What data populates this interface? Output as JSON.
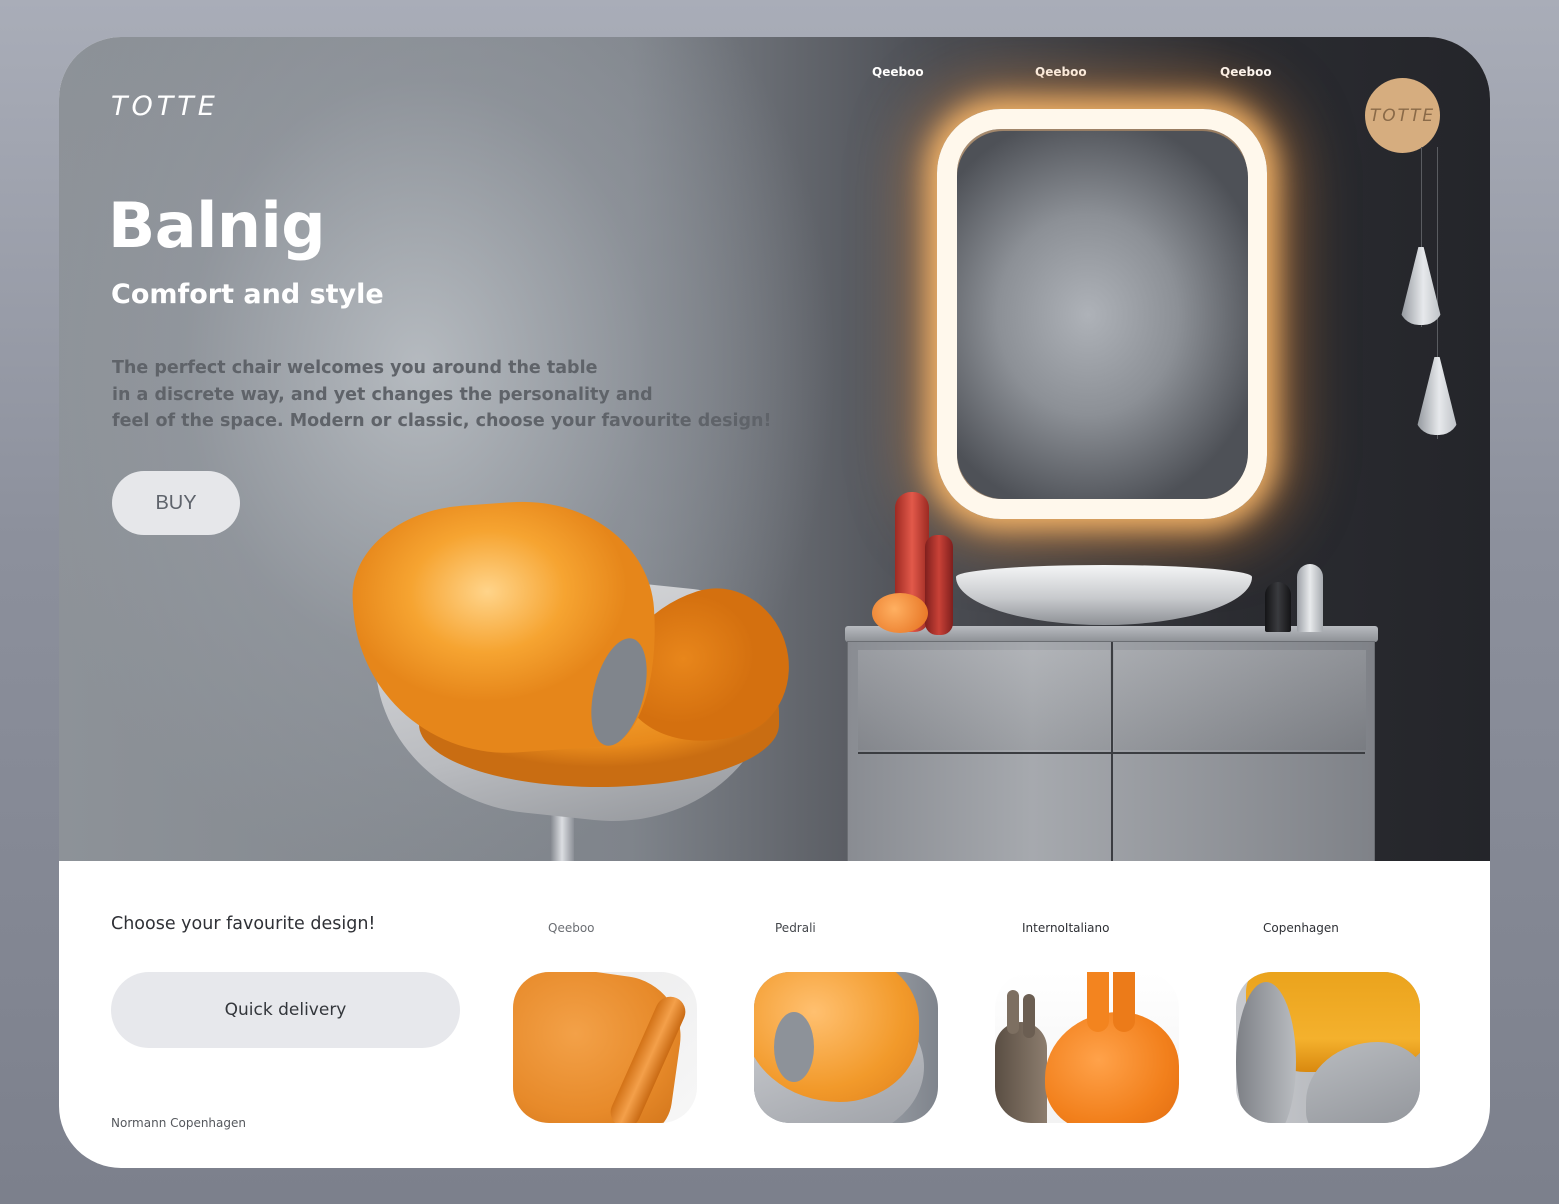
{
  "brand": {
    "logo": "TOTTE",
    "badge": "TOTTE"
  },
  "topnav": [
    "Qeeboo",
    "Qeeboo",
    "Qeeboo"
  ],
  "hero": {
    "title": "Balnig",
    "subtitle": "Comfort and style",
    "description": [
      "The perfect chair welcomes you around the table",
      "in a discrete way, and yet changes the personality and",
      "feel of the space. Modern or classic, choose your favourite design!"
    ],
    "buy_label": "BUY"
  },
  "bottom": {
    "heading": "Choose your favourite design!",
    "quick_delivery": "Quick delivery",
    "footer_brand": "Normann Copenhagen",
    "categories": [
      {
        "label": "Qeeboo",
        "color": "#6b6e73"
      },
      {
        "label": "Pedrali",
        "color": "#44474c"
      },
      {
        "label": "InternoItaliano",
        "color": "#2f3136"
      },
      {
        "label": "Copenhagen",
        "color": "#2f3136"
      }
    ]
  },
  "colors": {
    "accent_orange": "#f08a1c",
    "badge_gold": "#d6ad7f",
    "button_grey": "#e6e7ea"
  }
}
